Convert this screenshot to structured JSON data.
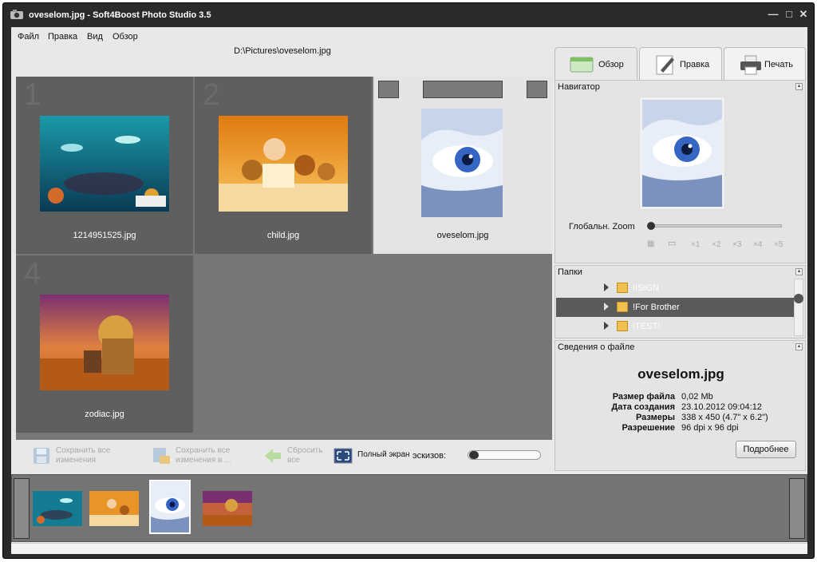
{
  "window": {
    "title": "oveselom.jpg  -  Soft4Boost Photo Studio 3.5"
  },
  "menu": [
    "Файл",
    "Правка",
    "Вид",
    "Обзор"
  ],
  "path": "D:\\Pictures\\oveselom.jpg",
  "grid": {
    "cells": [
      {
        "num": "1",
        "label": "1214951525.jpg",
        "image": "underwater"
      },
      {
        "num": "2",
        "label": "child.jpg",
        "image": "child-teddy-bears"
      },
      {
        "num": "",
        "label": "oveselom.jpg",
        "image": "frosted-eye",
        "selected": true
      },
      {
        "num": "4",
        "label": "zodiac.jpg",
        "image": "lion-desert"
      }
    ]
  },
  "toolbar": {
    "save_all": "Сохранить все изменения",
    "save_all_as": "Сохранить все изменения в ...",
    "reset_all": "Сбросить все",
    "fullscreen": "Полный экран",
    "thumbs_label": "эскизов:"
  },
  "tabs": [
    "Обзор",
    "Правка",
    "Печать"
  ],
  "navigator": {
    "title": "Навигатор",
    "zoom_label": "Глобальн. Zoom",
    "zoom_value": 0,
    "zoom_options": [
      "×1",
      "×2",
      "×3",
      "×4",
      "×5"
    ]
  },
  "folders": {
    "title": "Папки",
    "items": [
      "!!SIGN",
      "!For Brother",
      "!TEST!"
    ],
    "selected_index": 1
  },
  "fileinfo": {
    "title": "Сведения о файле",
    "filename": "oveselom.jpg",
    "rows": [
      {
        "k": "Размер файла",
        "v": "0,02 Mb"
      },
      {
        "k": "Дата создания",
        "v": "23.10.2012  09:04:12"
      },
      {
        "k": "Размеры",
        "v": "338 x 450 (4.7\" x 6.2\")"
      },
      {
        "k": "Разрешение",
        "v": "96 dpi x 96 dpi"
      }
    ],
    "more_button": "Подробнее"
  },
  "colors": {
    "accent_folder": "#f0c050",
    "selected_row": "#5a5a5a",
    "titlebar": "#2a2a2a"
  }
}
